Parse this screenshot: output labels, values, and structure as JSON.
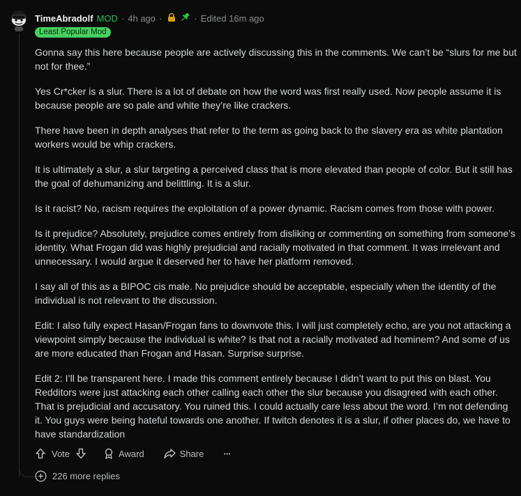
{
  "comment": {
    "author": "TimeAbradolf",
    "mod_tag": "MOD",
    "time": "4h ago",
    "edited": "Edited 16m ago",
    "flair": "Least Popular Mod",
    "flair_color": "#46d160",
    "mod_color": "#2bc04e",
    "icons": [
      "avatar",
      "lock-icon",
      "pin-icon"
    ],
    "paragraphs": [
      "Gonna say this here because people are actively discussing this in the comments. We can’t be “slurs for me but not for thee.”",
      "Yes Cr*cker is a slur. There is a lot of debate on how the word was first really used. Now people assume it is because people are so pale and white they’re like crackers.",
      "There have been in depth analyses that refer to the term as going back to the slavery era as white plantation workers would be whip crackers.",
      "It is ultimately a slur, a slur targeting a perceived class that is more elevated than people of color. But it still has the goal of dehumanizing and belittling. It is a slur.",
      "Is it racist? No, racism requires the exploitation of a power dynamic. Racism comes from those with power.",
      "Is it prejudice? Absolutely, prejudice comes entirely from disliking or commenting on something from someone’s identity. What Frogan did was highly prejudicial and racially motivated in that comment. It was irrelevant and unnecessary. I would argue it deserved her to have her platform removed.",
      "I say all of this as a BIPOC cis male. No prejudice should be acceptable, especially when the identity of the individual is not relevant to the discussion.",
      "Edit: I also fully expect Hasan/Frogan fans to downvote this. I will just completely echo, are you not attacking a viewpoint simply because the individual is white? Is that not a racially motivated ad hominem? And some of us are more educated than Frogan and Hasan. Surprise surprise.",
      "Edit 2: I’ll be transparent here. I made this comment entirely because I didn’t want to put this on blast. You Redditors were just attacking each other calling each other the slur because you disagreed with each other. That is prejudicial and accusatory. You ruined this. I could actually care less about the word. I’m not defending it. You guys were being hateful towards one another. If twitch denotes it is a slur, if other places do, we have to have standardization"
    ]
  },
  "actions": {
    "vote_label": "Vote",
    "award_label": "Award",
    "share_label": "Share",
    "more_label": "···"
  },
  "replies": {
    "label": "226 more replies"
  }
}
